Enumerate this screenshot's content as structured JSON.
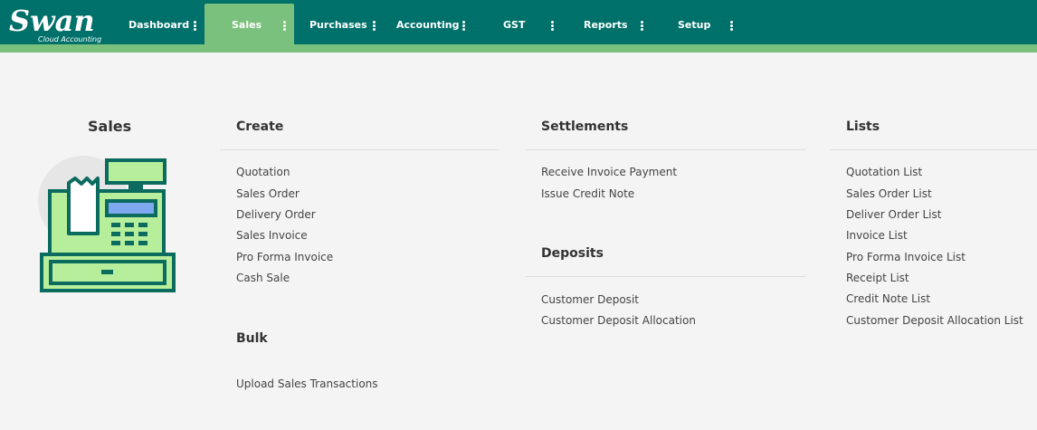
{
  "brand": {
    "name": "wan",
    "initial": "S",
    "tagline": "Cloud Accounting"
  },
  "nav": {
    "items": [
      {
        "label": "Dashboard",
        "active": false
      },
      {
        "label": "Sales",
        "active": true
      },
      {
        "label": "Purchases",
        "active": false
      },
      {
        "label": "Accounting",
        "active": false
      },
      {
        "label": "GST",
        "active": false
      },
      {
        "label": "Reports",
        "active": false
      },
      {
        "label": "Setup",
        "active": false
      }
    ]
  },
  "colors": {
    "topbar": "#00706a",
    "accent": "#7ac17d",
    "background": "#f4f4f4",
    "illustration_green": "#b7ee9c",
    "illustration_teal": "#0b6b5e"
  },
  "sidebar": {
    "title": "Sales",
    "icon": "cash-register-icon"
  },
  "create": {
    "title": "Create",
    "links": [
      "Quotation",
      "Sales Order",
      "Delivery Order",
      "Sales Invoice",
      "Pro Forma Invoice",
      "Cash Sale"
    ]
  },
  "bulk": {
    "title": "Bulk",
    "links": [
      "Upload Sales Transactions"
    ]
  },
  "settlements": {
    "title": "Settlements",
    "links": [
      "Receive Invoice Payment",
      "Issue Credit Note"
    ]
  },
  "deposits": {
    "title": "Deposits",
    "links": [
      "Customer Deposit",
      "Customer Deposit Allocation"
    ]
  },
  "lists": {
    "title": "Lists",
    "links": [
      "Quotation List",
      "Sales Order List",
      "Deliver Order List",
      "Invoice List",
      "Pro Forma Invoice List",
      "Receipt List",
      "Credit Note List",
      "Customer Deposit Allocation List"
    ]
  }
}
